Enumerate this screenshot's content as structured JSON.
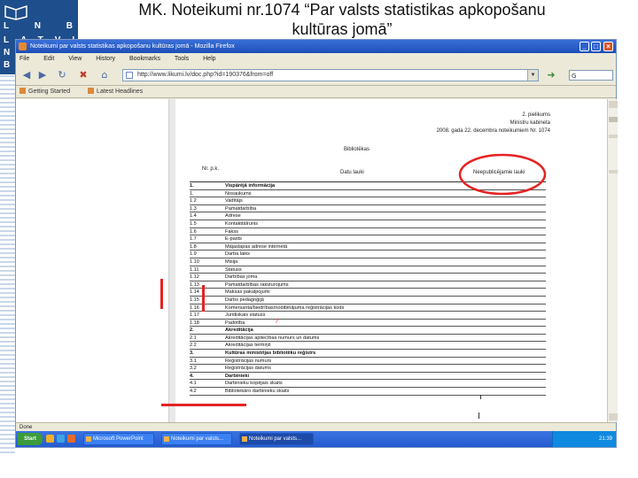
{
  "slide": {
    "title_line1": "MK. Noteikumi nr.1074 “Par valsts statistikas apkopošanu",
    "title_line2": "kultūras jomā”"
  },
  "logo": {
    "rows": [
      "L N B",
      "LATVIJAS",
      "NA",
      "BI"
    ]
  },
  "browser": {
    "window_title": "Noteikumi par valsts statistikas apkopošanu kultūras jomā - Mozilla Firefox",
    "menu": [
      "File",
      "Edit",
      "View",
      "History",
      "Bookmarks",
      "Tools",
      "Help"
    ],
    "url": "http://www.likumi.lv/doc.php?id=190376&from=off",
    "bookmarks": [
      "Getting Started",
      "Latest Headlines"
    ],
    "status": "Done"
  },
  "document": {
    "annex": [
      "2. pielikums",
      "Ministru kabineta",
      "2008. gada 22. decembra noteikumiem Nr. 1074"
    ],
    "table_title": "Bibliotēkas",
    "headers": {
      "nr": "Nr. p.k.",
      "data": "Datu lauki",
      "public": "Neepublicējamie lauki"
    },
    "rows": [
      {
        "nr": "1.",
        "name": "Vispārējā informācija",
        "bold": true
      },
      {
        "nr": "1.",
        "name": "Nosaukums"
      },
      {
        "nr": "1.2",
        "name": "Vadītājs"
      },
      {
        "nr": "1.3",
        "name": "Pamatdarbība"
      },
      {
        "nr": "1.4",
        "name": "Adrese"
      },
      {
        "nr": "1.5",
        "name": "Kontakttālrunis"
      },
      {
        "nr": "1.6",
        "name": "Fakss"
      },
      {
        "nr": "1.7",
        "name": "E-pasts"
      },
      {
        "nr": "1.8",
        "name": "Mājaslapas adrese internetā"
      },
      {
        "nr": "1.9",
        "name": "Darba laiks"
      },
      {
        "nr": "1.10",
        "name": "Misija"
      },
      {
        "nr": "1.11",
        "name": "Statuss"
      },
      {
        "nr": "1.12",
        "name": "Darbības joma"
      },
      {
        "nr": "1.13",
        "name": "Pamatdarbības raksturojums"
      },
      {
        "nr": "1.14",
        "name": "Maksas pakalpojumi"
      },
      {
        "nr": "1.15",
        "name": "Darbs pedagoģijā"
      },
      {
        "nr": "1.16",
        "name": "Komersanta/biedrības/nodibinājuma reģistrācijas kods"
      },
      {
        "nr": "1.17",
        "name": "Juridiskais statuss"
      },
      {
        "nr": "1.18",
        "name": "Padotība"
      },
      {
        "nr": "2.",
        "name": "Akreditācija",
        "bold": true
      },
      {
        "nr": "2.1",
        "name": "Akreditācijas apliecības numurs un datums"
      },
      {
        "nr": "2.2",
        "name": "Akreditācijas termiņš"
      },
      {
        "nr": "3.",
        "name": "Kultūras ministrijas bibliotēku reģistrs",
        "bold": true
      },
      {
        "nr": "3.1",
        "name": "Reģistrācijas numurs"
      },
      {
        "nr": "3.2",
        "name": "Reģistrācijas datums"
      },
      {
        "nr": "4.",
        "name": "Darbinieki",
        "bold": true
      },
      {
        "nr": "4.1",
        "name": "Darbinieku kopējais skaits"
      },
      {
        "nr": "4.2",
        "name": "Bibliotekāro darbinieku skaits"
      }
    ],
    "handwritten_note": "?"
  },
  "taskbar": {
    "start": "Start",
    "tasks": [
      "Microsoft PowerPoint",
      "Noteikumi par valsts...",
      "Noteikumi par valsts..."
    ],
    "clock": "21:39"
  },
  "colors": {
    "annotation": "#e52222",
    "titlebar": "#1d4fb7",
    "logo": "#1f4e8c"
  }
}
